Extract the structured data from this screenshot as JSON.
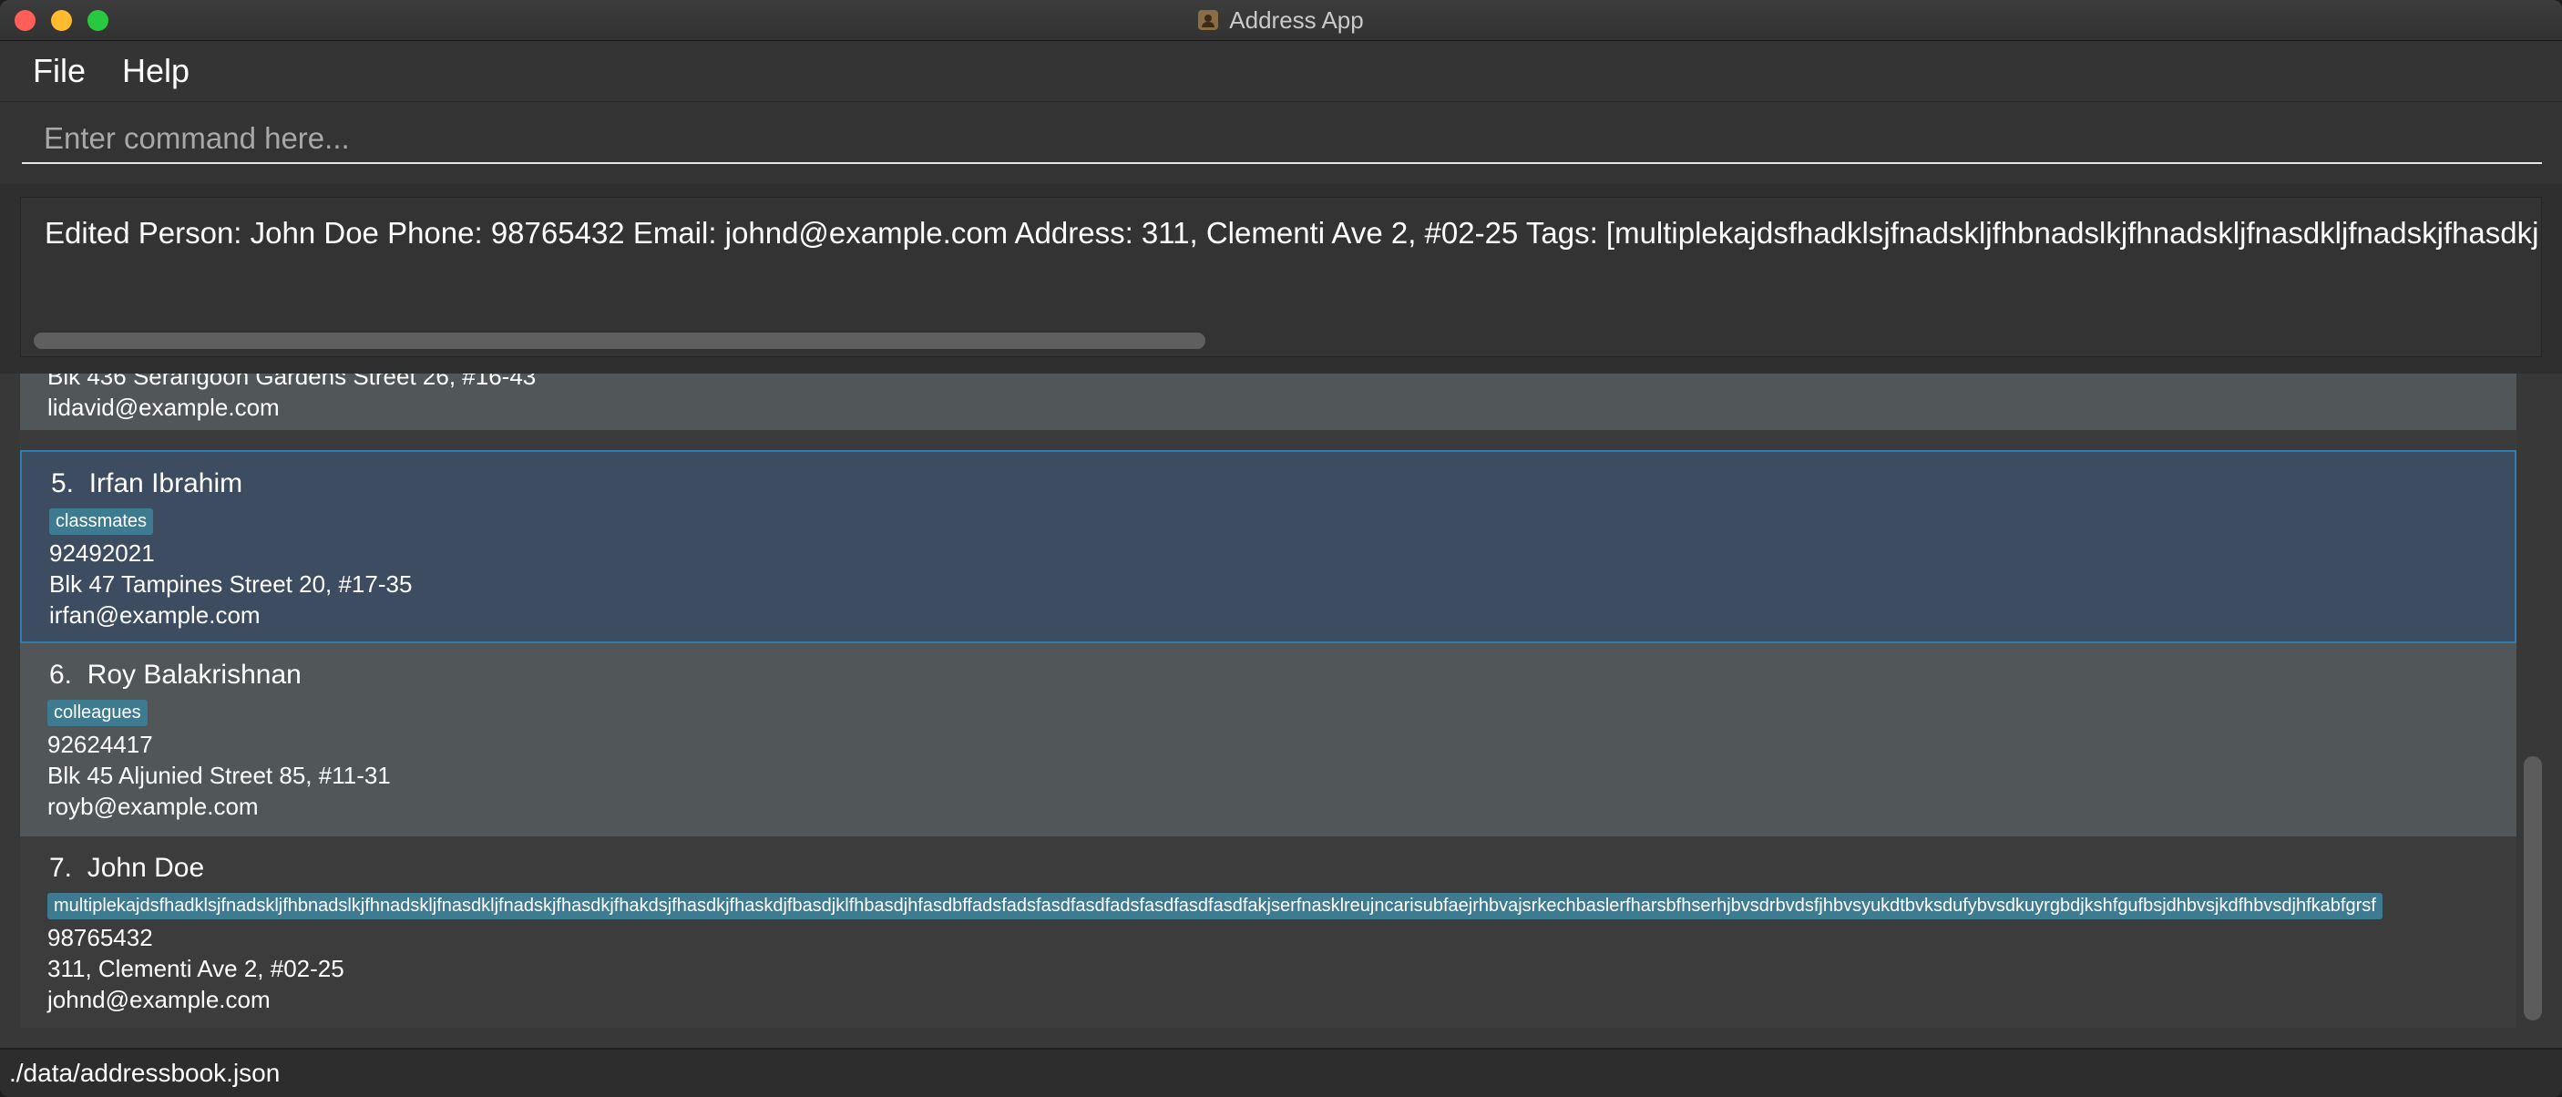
{
  "window": {
    "title": "Address App"
  },
  "menu": {
    "items": [
      "File",
      "Help"
    ]
  },
  "command": {
    "placeholder": "Enter command here...",
    "value": ""
  },
  "result": {
    "text": "Edited Person: John Doe Phone: 98765432 Email: johnd@example.com Address: 311, Clementi Ave 2, #02-25 Tags: [multiplekajdsfhadklsjfnadskljfhbnadslkjfhnadskljfnasdkljfnadskjfhasdkj"
  },
  "persons": {
    "partial": {
      "address": "Blk 436 Serangoon Gardens Street 26, #16-43",
      "email": "lidavid@example.com"
    },
    "items": [
      {
        "index": "5.",
        "name": "Irfan Ibrahim",
        "tag": "classmates",
        "phone": "92492021",
        "address": "Blk 47 Tampines Street 20, #17-35",
        "email": "irfan@example.com"
      },
      {
        "index": "6.",
        "name": "Roy Balakrishnan",
        "tag": "colleagues",
        "phone": "92624417",
        "address": "Blk 45 Aljunied Street 85, #11-31",
        "email": "royb@example.com"
      },
      {
        "index": "7.",
        "name": "John Doe",
        "tag": "multiplekajdsfhadklsjfnadskljfhbnadslkjfhnadskljfnasdkljfnadskjfhasdkjfhakdsjfhasdkjfhaskdjfbasdjklfhbasdjhfasdbffadsfadsfasdfasdfadsfasdfasdfasdfakjserfnasklreujncarisubfaejrhbvajsrkechbaslerfharsbfhserhjbvsdrbvdsfjhbvsyukdtbvksdufybvsdkuyrgbdjkshfgufbsjdhbvsjkdfhbvsdjhfkabfgrsf",
        "phone": "98765432",
        "address": "311, Clementi Ave 2, #02-25",
        "email": "johnd@example.com"
      }
    ]
  },
  "status": {
    "path": "./data/addressbook.json"
  }
}
